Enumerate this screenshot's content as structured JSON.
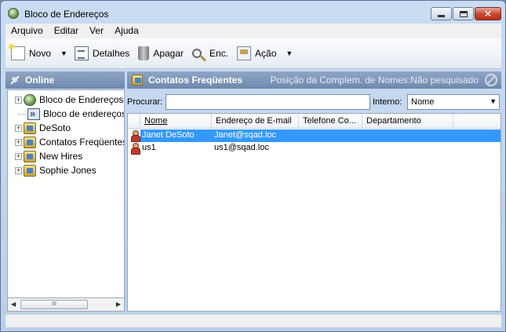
{
  "window": {
    "title": "Bloco de Endereços"
  },
  "menu": [
    "Arquivo",
    "Editar",
    "Ver",
    "Ajuda"
  ],
  "toolbar": {
    "new_label": "Novo",
    "details_label": "Detalhes",
    "delete_label": "Apagar",
    "find_label": "Enc.",
    "action_label": "Ação"
  },
  "left_panel": {
    "header": "Online",
    "tree": [
      {
        "label": "Bloco de Endereços c",
        "icon": "globe-book-icon",
        "expander": "+"
      },
      {
        "label": "Bloco de endereços L",
        "icon": "ldap-directory-icon",
        "expander": ""
      },
      {
        "label": "DeSoto",
        "icon": "address-book-icon",
        "expander": "+"
      },
      {
        "label": "Contatos Freqüentes",
        "icon": "address-book-icon",
        "expander": "+"
      },
      {
        "label": "New Hires",
        "icon": "address-book-icon",
        "expander": "+"
      },
      {
        "label": "Sophie Jones",
        "icon": "address-book-icon",
        "expander": "+"
      }
    ]
  },
  "right_panel": {
    "header": "Contatos Freqüentes",
    "status": "Posição da Complem. de Nomes:Não pesquisado",
    "search_label": "Procurar:",
    "search_value": "",
    "interno_label": "Interno:",
    "interno_selected": "Nome",
    "columns": [
      "Nome",
      "Endereço de E-mail",
      "Telefone Co...",
      "Departamento"
    ],
    "rows": [
      {
        "name": "Janet DeSoto",
        "email": "Janet@sqad.loc",
        "phone": "",
        "department": "",
        "selected": true
      },
      {
        "name": "us1",
        "email": "us1@sqad.loc",
        "phone": "",
        "department": "",
        "selected": false
      }
    ]
  },
  "scrollbar": {
    "thumb_grip": "III"
  },
  "colors": {
    "selection": "#3399ff",
    "header_bar": "#7a92b4"
  }
}
